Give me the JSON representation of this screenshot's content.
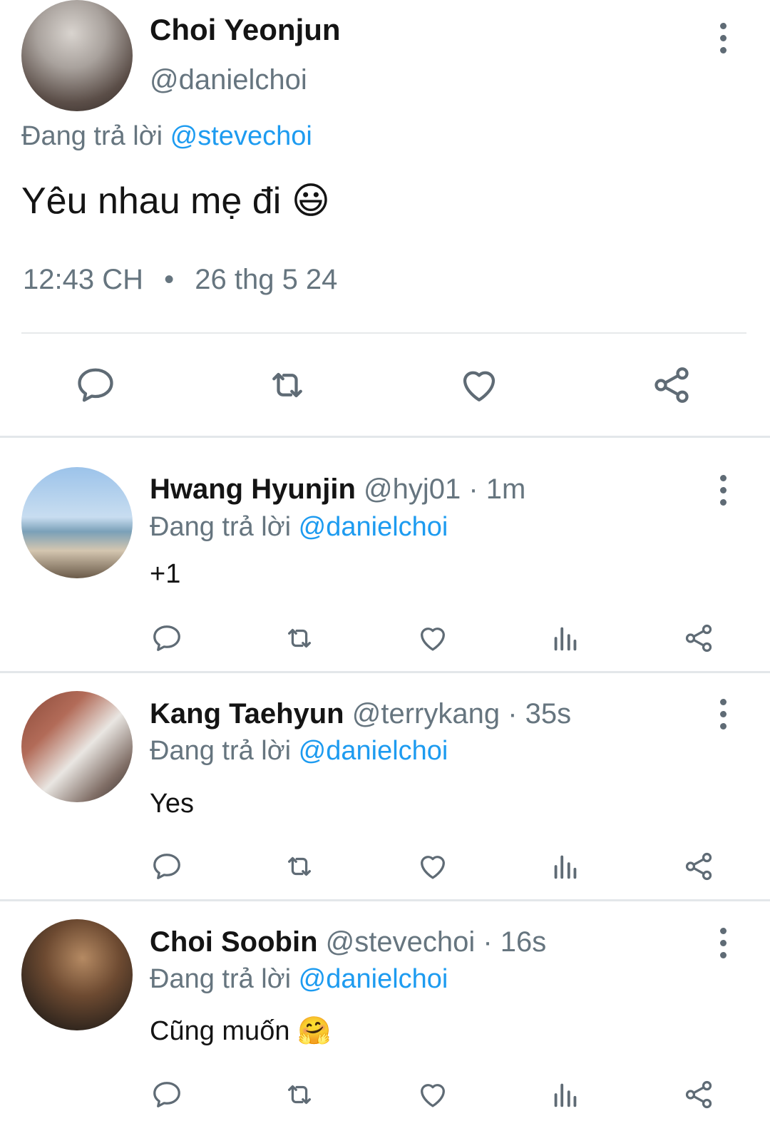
{
  "main_tweet": {
    "name": "Choi Yeonjun",
    "handle": "@danielchoi",
    "replying_prefix": "Đang trả lời",
    "replying_to": "@stevechoi",
    "text": "Yêu nhau mẹ đi",
    "emoji": "😃",
    "time": "12:43 CH",
    "separator": "•",
    "date": "26 thg 5 24"
  },
  "replies": [
    {
      "name": "Hwang Hyunjin",
      "handle": "@hyj01",
      "meta": "· 1m",
      "replying_prefix": "Đang trả lời",
      "replying_to": "@danielchoi",
      "text": "+1"
    },
    {
      "name": "Kang Taehyun",
      "handle": "@terrykang",
      "meta": "· 35s",
      "replying_prefix": "Đang trả lời",
      "replying_to": "@danielchoi",
      "text": "Yes"
    },
    {
      "name": "Choi Soobin",
      "handle": "@stevechoi",
      "meta": "· 16s",
      "replying_prefix": "Đang trả lời",
      "replying_to": "@danielchoi",
      "text": "Cũng muốn",
      "emoji": "🤗"
    }
  ],
  "icons": {
    "reply": "reply-icon",
    "retweet": "retweet-icon",
    "like": "like-icon",
    "views": "views-icon",
    "share": "share-icon",
    "more": "more-icon"
  },
  "colors": {
    "link": "#1d9bf0",
    "muted": "#66757f",
    "icon": "#5f6b75"
  }
}
